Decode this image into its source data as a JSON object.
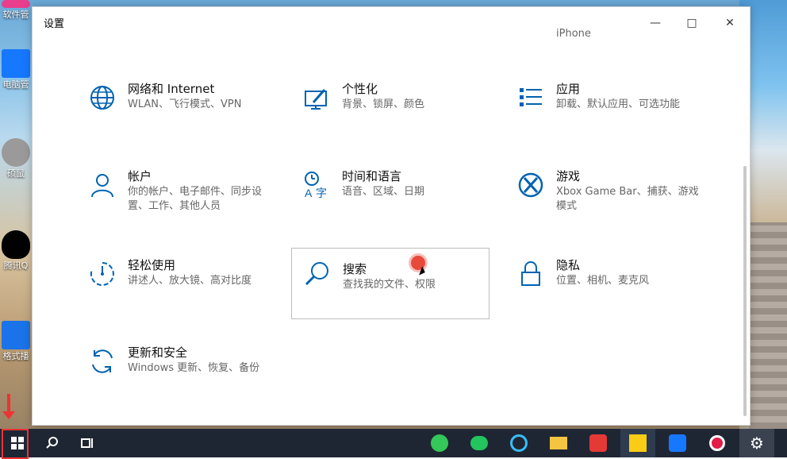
{
  "desktop": {
    "icons": [
      {
        "name": "软件管家",
        "label": "软件管"
      },
      {
        "name": "电脑管家",
        "label": "电脑管"
      },
      {
        "name": "硕鼠",
        "label": "硕鼠"
      },
      {
        "name": "腾讯QQ",
        "label": "腾讯Q"
      },
      {
        "name": "格式播",
        "label": "格式播"
      }
    ]
  },
  "window": {
    "title": "设置",
    "top_partial": "iPhone",
    "tiles": [
      {
        "name": "network-internet",
        "title": "网络和 Internet",
        "subtitle": "WLAN、飞行模式、VPN"
      },
      {
        "name": "personalization",
        "title": "个性化",
        "subtitle": "背景、锁屏、颜色"
      },
      {
        "name": "apps",
        "title": "应用",
        "subtitle": "卸载、默认应用、可选功能"
      },
      {
        "name": "accounts",
        "title": "帐户",
        "subtitle": "你的帐户、电子邮件、同步设置、工作、其他人员"
      },
      {
        "name": "time-language",
        "title": "时间和语言",
        "subtitle": "语音、区域、日期"
      },
      {
        "name": "gaming",
        "title": "游戏",
        "subtitle": "Xbox Game Bar、捕获、游戏模式"
      },
      {
        "name": "ease-of-access",
        "title": "轻松使用",
        "subtitle": "讲述人、放大镜、高对比度"
      },
      {
        "name": "search",
        "title": "搜索",
        "subtitle": "查找我的文件、权限"
      },
      {
        "name": "privacy",
        "title": "隐私",
        "subtitle": "位置、相机、麦克风"
      },
      {
        "name": "update-security",
        "title": "更新和安全",
        "subtitle": "Windows 更新、恢复、备份"
      }
    ]
  },
  "colors": {
    "accent": "#0063b1",
    "taskbar": "#1f2633",
    "highlight_red": "#e33"
  },
  "taskbar": {
    "items": [
      "start",
      "search",
      "task-view",
      "browser",
      "wechat",
      "qq-browser",
      "file-explorer",
      "wps",
      "sticky-app",
      "security",
      "record",
      "settings"
    ]
  }
}
